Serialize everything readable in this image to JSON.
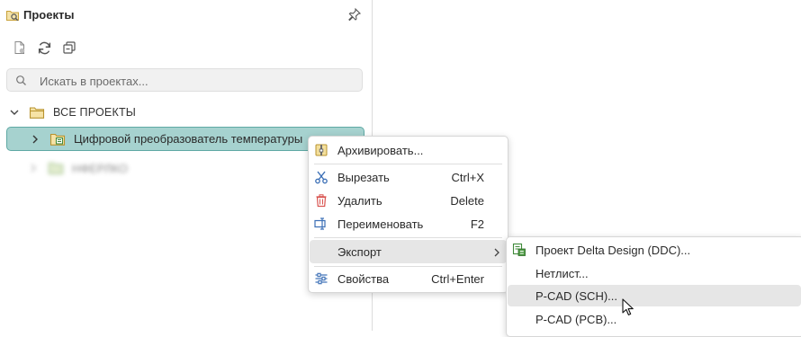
{
  "panel": {
    "title": "Проекты",
    "search_placeholder": "Искать в проектах..."
  },
  "tree": {
    "root_label": "ВСЕ ПРОЕКТЫ",
    "selected_project": "Цифровой преобразователь температуры",
    "blurred_project": "НФЕРЛКО"
  },
  "context_menu": {
    "items": [
      {
        "label": "Архивировать...",
        "shortcut": ""
      },
      {
        "label": "Вырезать",
        "shortcut": "Ctrl+X"
      },
      {
        "label": "Удалить",
        "shortcut": "Delete"
      },
      {
        "label": "Переименовать",
        "shortcut": "F2"
      },
      {
        "label": "Экспорт",
        "shortcut": ""
      },
      {
        "label": "Свойства",
        "shortcut": "Ctrl+Enter"
      }
    ]
  },
  "export_menu": {
    "items": [
      {
        "label": "Проект Delta Design (DDC)..."
      },
      {
        "label": "Нетлист..."
      },
      {
        "label": "P-CAD (SCH)..."
      },
      {
        "label": "P-CAD (PCB)..."
      }
    ]
  },
  "colors": {
    "selection_bg": "#a6d2cf",
    "selection_border": "#5fa9a4",
    "folder": "#c9a23a",
    "menu_highlight": "#e6e6e6",
    "delete_red": "#d9534f",
    "icon_blue": "#3b6fb6"
  }
}
